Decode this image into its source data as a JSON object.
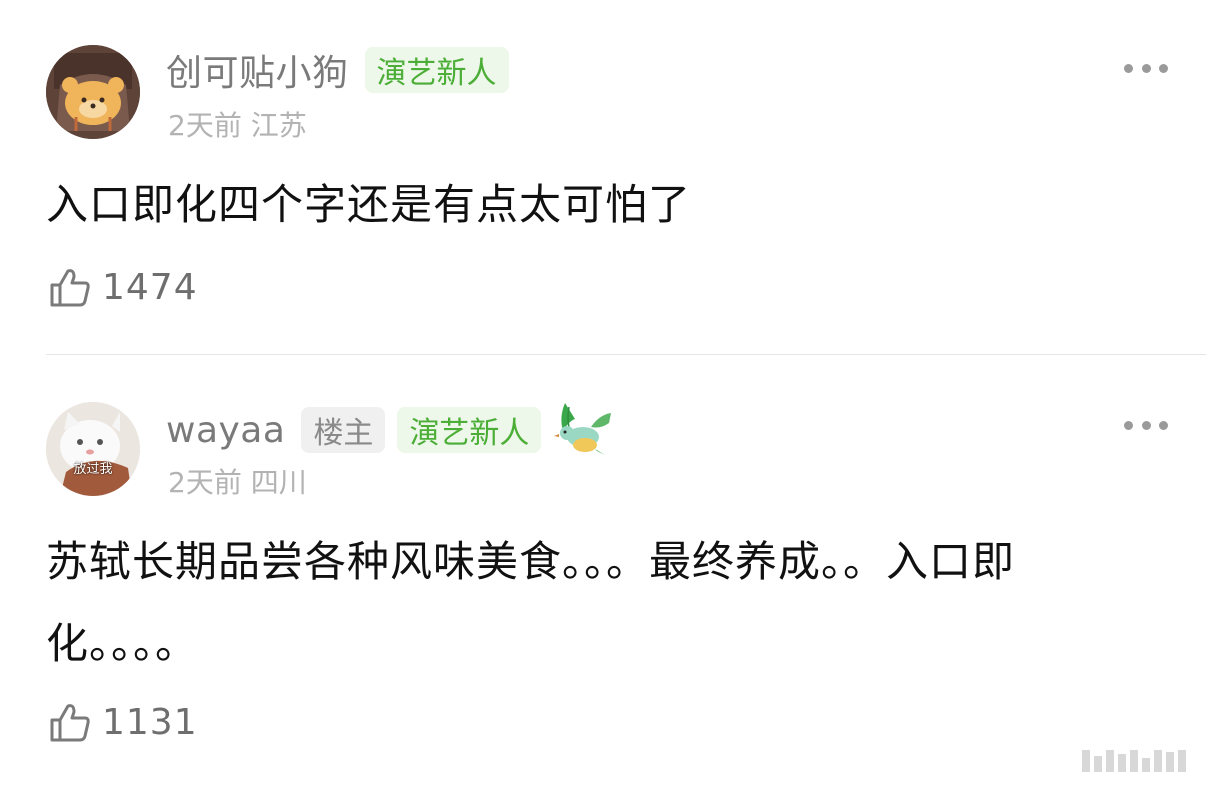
{
  "comments": [
    {
      "username": "创可贴小狗",
      "badges": [
        "演艺新人"
      ],
      "time": "2天前",
      "location": "江苏",
      "text": "入口即化四个字还是有点太可怕了",
      "likes": "1474"
    },
    {
      "username": "wayaa",
      "op_badge": "楼主",
      "badges": [
        "演艺新人"
      ],
      "time": "2天前",
      "location": "四川",
      "text": "苏轼长期品尝各种风味美食。。。最终养成。。入口即化。。。。",
      "likes": "1131",
      "avatar_caption": "放过我"
    }
  ],
  "icons": {
    "more": "more-dots-icon",
    "like": "thumbs-up-icon",
    "bird": "bird-sticker-icon"
  },
  "colors": {
    "badge_green_text": "#4cae36",
    "badge_green_bg": "#edf7ea",
    "meta_gray": "#b3b3b3",
    "username_gray": "#7a7a7a"
  }
}
